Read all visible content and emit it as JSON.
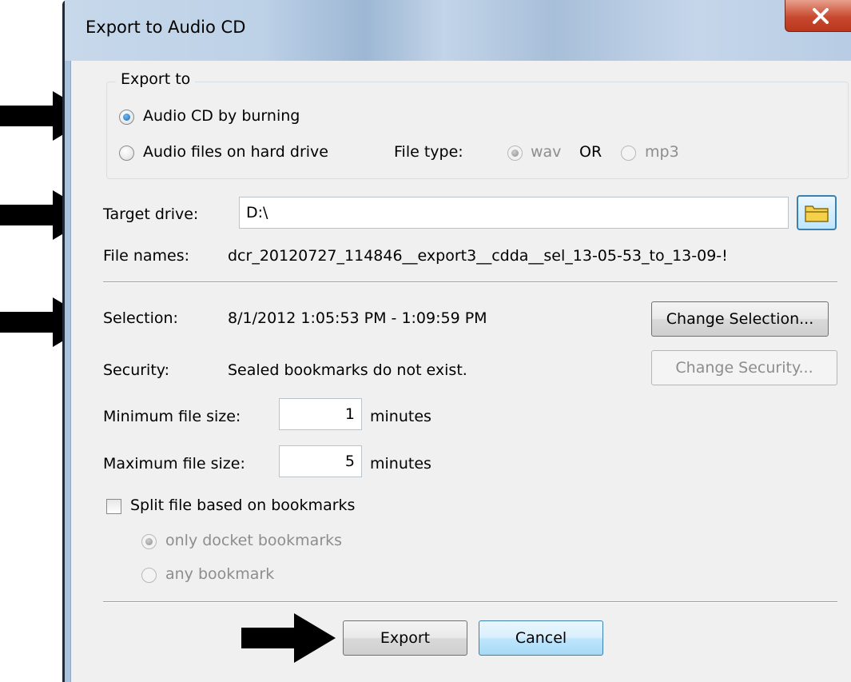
{
  "window": {
    "title": "Export to Audio CD"
  },
  "export_to": {
    "legend": "Export to",
    "option_cd": "Audio CD by burning",
    "option_files": "Audio files on hard drive",
    "file_type_label": "File type:",
    "wav": "wav",
    "or": "OR",
    "mp3": "mp3"
  },
  "target": {
    "label": "Target drive:",
    "value": "D:\\"
  },
  "file_names": {
    "label": "File names:",
    "value": "dcr_20120727_114846__export3__cdda__sel_13-05-53_to_13-09-!"
  },
  "selection": {
    "label": "Selection:",
    "value": "8/1/2012 1:05:53 PM - 1:09:59 PM",
    "button": "Change Selection..."
  },
  "security": {
    "label": "Security:",
    "value": "Sealed bookmarks do not exist.",
    "button": "Change Security..."
  },
  "min_size": {
    "label": "Minimum file size:",
    "value": "1",
    "unit": "minutes"
  },
  "max_size": {
    "label": "Maximum file size:",
    "value": "5",
    "unit": "minutes"
  },
  "split": {
    "label": "Split file based on bookmarks",
    "option_docket": "only docket bookmarks",
    "option_any": "any bookmark"
  },
  "buttons": {
    "export": "Export",
    "cancel": "Cancel"
  },
  "icons": {
    "close": "close-icon",
    "folder": "folder-icon",
    "arrow": "arrow-right-icon"
  },
  "colors": {
    "arrow": "#000000",
    "close_button": "#c8492f",
    "folder": "#f5d04a"
  }
}
